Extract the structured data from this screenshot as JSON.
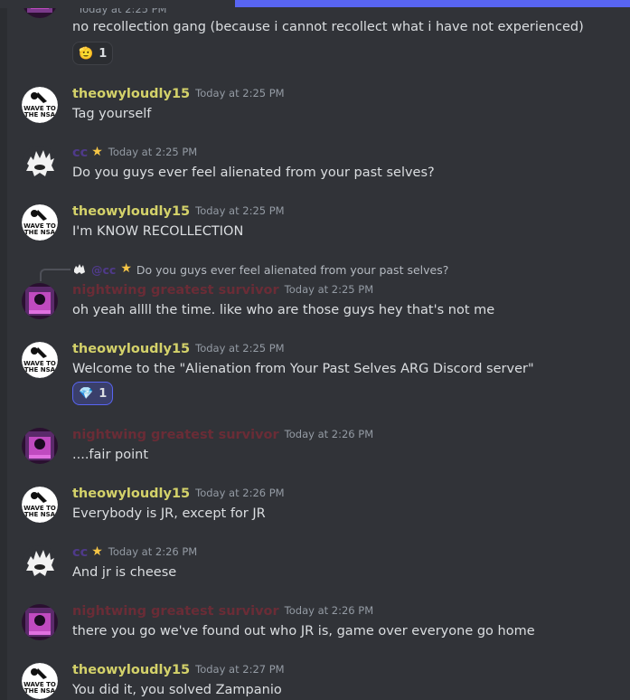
{
  "users": {
    "theo": {
      "name": "theowyloudly15",
      "avatar_text_1": "WAVE TO",
      "avatar_text_2": "THE NSA"
    },
    "night": {
      "name": "nightwing greatest survivor"
    },
    "cc": {
      "name": "cc"
    }
  },
  "reply": {
    "author": "@cc",
    "text": "Do you guys ever feel alienated from your past selves?"
  },
  "messages": [
    {
      "time": "Today at 2:25 PM",
      "text": "no recollection gang (because i cannot recollect what i have not experienced)",
      "reaction_emoji": "🫡",
      "reaction_count": "1"
    },
    {
      "time": "Today at 2:25 PM",
      "text": "Tag yourself"
    },
    {
      "time": "Today at 2:25 PM",
      "text": "Do you guys ever feel alienated from your past selves?"
    },
    {
      "time": "Today at 2:25 PM",
      "text": "I'm KNOW RECOLLECTION"
    },
    {
      "time": "Today at 2:25 PM",
      "text": "oh yeah allll the time. like who are those guys hey that's not me"
    },
    {
      "time": "Today at 2:25 PM",
      "text": "Welcome to the \"Alienation from Your Past Selves ARG Discord server\"",
      "reaction_emoji": "💎",
      "reaction_count": "1"
    },
    {
      "time": "Today at 2:26 PM",
      "text": "....fair point"
    },
    {
      "time": "Today at 2:26 PM",
      "text": "Everybody is JR, except for JR"
    },
    {
      "time": "Today at 2:26 PM",
      "text": "And jr is cheese"
    },
    {
      "time": "Today at 2:26 PM",
      "text": "there you go we've found out who JR is, game over everyone go home"
    },
    {
      "time": "Today at 2:27 PM",
      "text": "You did it, you solved Zampanio"
    }
  ]
}
